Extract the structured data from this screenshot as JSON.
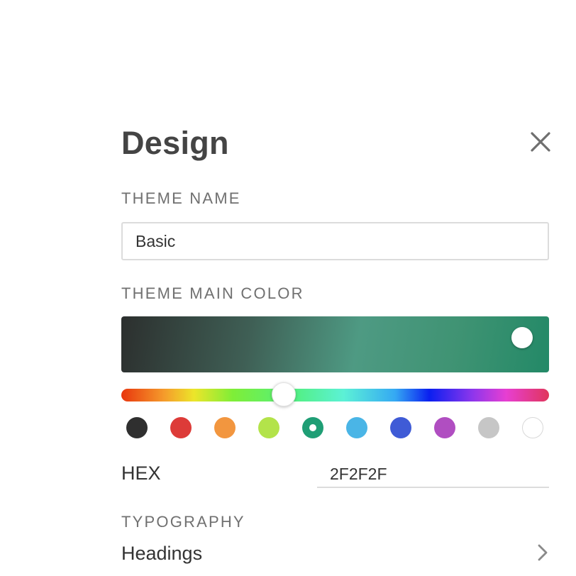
{
  "panel": {
    "title": "Design",
    "close_icon": "close-icon"
  },
  "theme_name": {
    "label": "THEME NAME",
    "value": "Basic"
  },
  "theme_main_color": {
    "label": "THEME MAIN COLOR",
    "hue_position_fraction": 0.38,
    "swatches": [
      {
        "name": "black",
        "color": "#2f2f2f",
        "selected": false
      },
      {
        "name": "red",
        "color": "#dd3b38",
        "selected": false
      },
      {
        "name": "orange",
        "color": "#f2963f",
        "selected": false
      },
      {
        "name": "lime",
        "color": "#b3e34a",
        "selected": false
      },
      {
        "name": "green",
        "color": "#1f9e75",
        "selected": true
      },
      {
        "name": "sky-blue",
        "color": "#4ab5e6",
        "selected": false
      },
      {
        "name": "blue",
        "color": "#3f5bd6",
        "selected": false
      },
      {
        "name": "purple",
        "color": "#b04ec1",
        "selected": false
      },
      {
        "name": "gray",
        "color": "#c6c6c6",
        "selected": false
      },
      {
        "name": "white",
        "color": "#ffffff",
        "selected": false
      }
    ]
  },
  "hex": {
    "label": "HEX",
    "value": "2F2F2F"
  },
  "typography": {
    "label": "TYPOGRAPHY",
    "headings_label": "Headings",
    "chevron_icon": "chevron-right-icon"
  }
}
